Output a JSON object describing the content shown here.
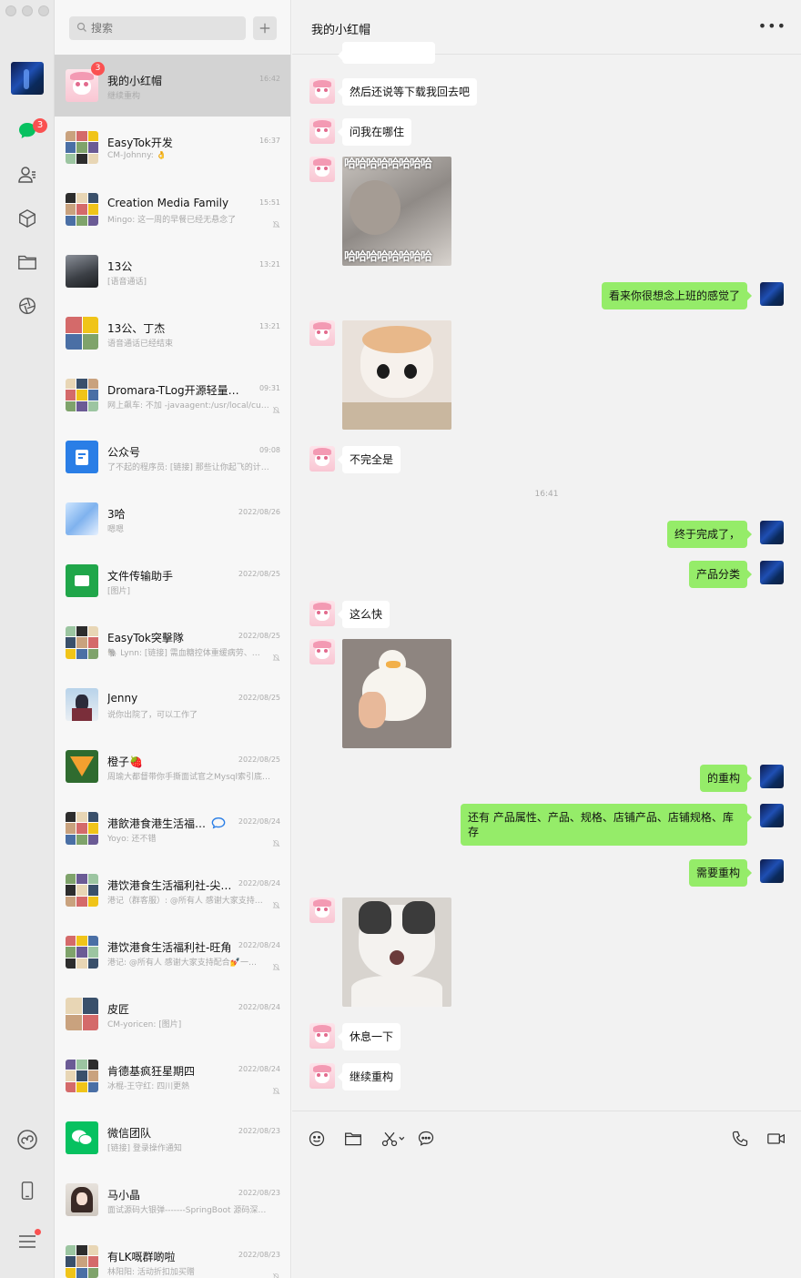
{
  "sidebar": {
    "unread_badge": "3"
  },
  "search": {
    "placeholder": "搜索"
  },
  "chats": [
    {
      "name": "我的小红帽",
      "time": "16:42",
      "preview": "继续重构",
      "badge": "3",
      "active": true,
      "avatar": "pink"
    },
    {
      "name": "EasyTok开发",
      "time": "16:37",
      "preview": "CM-Johnny: 👌",
      "avatar": "grid"
    },
    {
      "name": "Creation Media Family",
      "time": "15:51",
      "preview": "Mingo: 这一周的早餐已经无悬念了",
      "muted": true,
      "avatar": "grid"
    },
    {
      "name": "13公",
      "time": "13:21",
      "preview": "[语音通话]",
      "avatar": "photo"
    },
    {
      "name": "13公、丁杰",
      "time": "13:21",
      "preview": "语音通话已经结束",
      "avatar": "grid4"
    },
    {
      "name": "Dromara-TLog开源轻量级日…",
      "time": "09:31",
      "preview": "网上飙车: 不加 -javaagent:/usr/local/cu…",
      "muted": true,
      "avatar": "grid"
    },
    {
      "name": "公众号",
      "time": "09:08",
      "preview": "了不起的程序员: [链接] 那些让你起飞的计…",
      "avatar": "blue"
    },
    {
      "name": "3哈",
      "time": "2022/08/26",
      "preview": "嗯嗯",
      "avatar": "sky"
    },
    {
      "name": "文件传输助手",
      "time": "2022/08/25",
      "preview": "[图片]",
      "avatar": "green-file"
    },
    {
      "name": "EasyTok突擊隊",
      "time": "2022/08/25",
      "preview": "🐘 Lynn: [链接] 需血糖控体重缓病劳、…",
      "muted": true,
      "avatar": "grid"
    },
    {
      "name": "Jenny",
      "time": "2022/08/25",
      "preview": "说你出院了，可以工作了",
      "avatar": "jenny"
    },
    {
      "name": "橙子🍓",
      "time": "2022/08/25",
      "preview": "周瑜大都督带你手撕面试官之Mysql索引底…",
      "avatar": "fox"
    },
    {
      "name": "港飲港食港生活福…",
      "time": "2022/08/24",
      "preview": "Yoyo: 还不错",
      "muted": true,
      "avatar": "grid"
    },
    {
      "name": "港饮港食生活福利社-尖…",
      "time": "2022/08/24",
      "preview": "港记（群客服）: @所有人 感谢大家支持…",
      "muted": true,
      "avatar": "grid"
    },
    {
      "name": "港饮港食生活福利社-旺角",
      "time": "2022/08/24",
      "preview": "港记: @所有人 感谢大家支持配合💅一…",
      "muted": true,
      "avatar": "grid"
    },
    {
      "name": "皮匠",
      "time": "2022/08/24",
      "preview": "CM-yoricen: [图片]",
      "avatar": "grid4"
    },
    {
      "name": "肯德基疯狂星期四",
      "time": "2022/08/24",
      "preview": "冰棍-王守红: 四川更熱",
      "muted": true,
      "avatar": "grid"
    },
    {
      "name": "微信团队",
      "time": "2022/08/23",
      "preview": "[链接] 登录操作通知",
      "avatar": "wechat"
    },
    {
      "name": "马小晶",
      "time": "2022/08/23",
      "preview": "面试源码大银弹-------SpringBoot 源码深…",
      "avatar": "girl"
    },
    {
      "name": "有LK嘅群啲啦",
      "time": "2022/08/23",
      "preview": "林阳阳: 活动折扣加买赠",
      "muted": true,
      "avatar": "grid"
    }
  ],
  "conversation": {
    "title": "我的小红帽",
    "messages": [
      {
        "type": "text",
        "dir": "in",
        "text": "然后还说等下载我回去吧"
      },
      {
        "type": "text",
        "dir": "in",
        "text": "问我在哪住"
      },
      {
        "type": "image",
        "dir": "in",
        "image": "haha-cat",
        "text": "哈哈哈哈哈哈哈哈"
      },
      {
        "type": "text",
        "dir": "out",
        "text": "看来你很想念上班的感觉了"
      },
      {
        "type": "image",
        "dir": "in",
        "image": "cute-cat"
      },
      {
        "type": "text",
        "dir": "in",
        "text": "不完全是"
      },
      {
        "type": "time",
        "text": "16:41"
      },
      {
        "type": "text",
        "dir": "out",
        "text": "终于完成了，"
      },
      {
        "type": "text",
        "dir": "out",
        "text": "产品分类"
      },
      {
        "type": "text",
        "dir": "in",
        "text": "这么快"
      },
      {
        "type": "image",
        "dir": "in",
        "image": "duck"
      },
      {
        "type": "text",
        "dir": "out",
        "text": "的重构"
      },
      {
        "type": "text",
        "dir": "out",
        "text": "还有 产品属性、产品、规格、店铺产品、店铺规格、库存"
      },
      {
        "type": "text",
        "dir": "out",
        "text": "需要重构"
      },
      {
        "type": "image",
        "dir": "in",
        "image": "shock-cat"
      },
      {
        "type": "text",
        "dir": "in",
        "text": "休息一下"
      },
      {
        "type": "text",
        "dir": "in",
        "text": "继续重构"
      }
    ]
  },
  "toolbar": [
    "emoji-icon",
    "folder-icon",
    "scissors-icon",
    "chat-history-icon",
    "phone-icon",
    "video-icon"
  ],
  "colors": {
    "bubble_out": "#95ec69",
    "bubble_in": "#ffffff",
    "badge": "#fa5151",
    "wechat_green": "#07c160"
  }
}
